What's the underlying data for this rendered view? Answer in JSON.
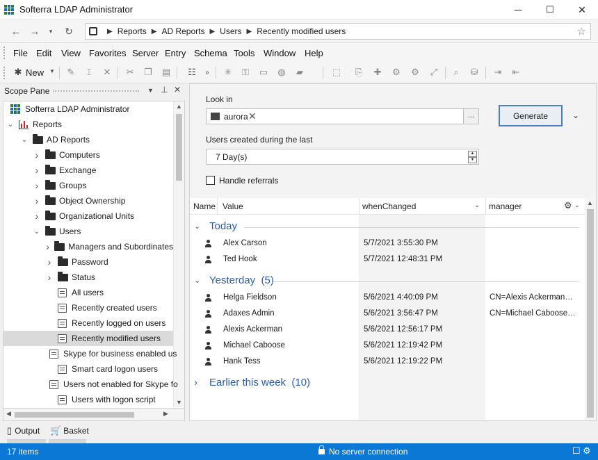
{
  "window": {
    "title": "Softerra LDAP Administrator",
    "controls": {
      "minimize": "─",
      "maximize": "☐",
      "close": "✕"
    }
  },
  "nav": {
    "back_icon": "arrow-left-icon",
    "forward_icon": "arrow-right-icon",
    "refresh_icon": "refresh-icon",
    "breadcrumbs": [
      "Reports",
      "AD Reports",
      "Users",
      "Recently modified users"
    ],
    "star_icon": "star-icon"
  },
  "menu": [
    "File",
    "Edit",
    "View",
    "Favorites",
    "Server",
    "Entry",
    "Schema",
    "Tools",
    "Window",
    "Help"
  ],
  "toolbar": {
    "new_label": "New"
  },
  "scope_pane": {
    "title": "Scope Pane",
    "tree": [
      {
        "label": "Softerra LDAP Administrator",
        "level": 0,
        "icon": "app-icon",
        "expander": ""
      },
      {
        "label": "Reports",
        "level": 0,
        "icon": "chart-icon",
        "expander": "expanded"
      },
      {
        "label": "AD Reports",
        "level": 1,
        "icon": "folder-icon",
        "expander": "expanded"
      },
      {
        "label": "Computers",
        "level": 2,
        "icon": "folder-icon",
        "expander": "collapsed"
      },
      {
        "label": "Exchange",
        "level": 2,
        "icon": "folder-icon",
        "expander": "collapsed"
      },
      {
        "label": "Groups",
        "level": 2,
        "icon": "folder-icon",
        "expander": "collapsed"
      },
      {
        "label": "Object Ownership",
        "level": 2,
        "icon": "folder-icon",
        "expander": "collapsed"
      },
      {
        "label": "Organizational Units",
        "level": 2,
        "icon": "folder-icon",
        "expander": "collapsed"
      },
      {
        "label": "Users",
        "level": 2,
        "icon": "folder-icon",
        "expander": "expanded"
      },
      {
        "label": "Managers and Subordinates",
        "level": 3,
        "icon": "folder-icon",
        "expander": "collapsed"
      },
      {
        "label": "Password",
        "level": 3,
        "icon": "folder-icon",
        "expander": "collapsed"
      },
      {
        "label": "Status",
        "level": 3,
        "icon": "folder-icon",
        "expander": "collapsed"
      },
      {
        "label": "All users",
        "level": 3,
        "icon": "report-icon",
        "expander": ""
      },
      {
        "label": "Recently created users",
        "level": 3,
        "icon": "report-icon",
        "expander": ""
      },
      {
        "label": "Recently logged on users",
        "level": 3,
        "icon": "report-icon",
        "expander": ""
      },
      {
        "label": "Recently modified users",
        "level": 3,
        "icon": "report-icon",
        "expander": "",
        "selected": true
      },
      {
        "label": "Skype for business enabled us",
        "level": 3,
        "icon": "report-icon",
        "expander": ""
      },
      {
        "label": "Smart card logon users",
        "level": 3,
        "icon": "report-icon",
        "expander": ""
      },
      {
        "label": "Users not enabled for Skype fo",
        "level": 3,
        "icon": "report-icon",
        "expander": ""
      },
      {
        "label": "Users with logon script",
        "level": 3,
        "icon": "report-icon",
        "expander": ""
      }
    ]
  },
  "form": {
    "look_in_label": "Look in",
    "look_in_value": "aurora",
    "browse_label": "...",
    "generate_label": "Generate",
    "period_label": "Users created during the last",
    "period_value": "7 Day(s)",
    "referrals_label": "Handle referrals",
    "referrals_checked": false
  },
  "grid": {
    "columns": [
      "Name",
      "Value",
      "whenChanged",
      "manager"
    ],
    "groups": [
      {
        "title": "Today",
        "expanded": true,
        "rows": [
          {
            "name": "Alex Carson",
            "whenChanged": "5/7/2021 3:55:30 PM",
            "manager": ""
          },
          {
            "name": "Ted Hook",
            "whenChanged": "5/7/2021 12:48:31 PM",
            "manager": ""
          }
        ]
      },
      {
        "title": "Yesterday  (5)",
        "expanded": true,
        "rows": [
          {
            "name": "Helga Fieldson",
            "whenChanged": "5/6/2021 4:40:09 PM",
            "manager": "CN=Alexis Ackerman…"
          },
          {
            "name": "Adaxes Admin",
            "whenChanged": "5/6/2021 3:56:47 PM",
            "manager": "CN=Michael Caboose…"
          },
          {
            "name": "Alexis Ackerman",
            "whenChanged": "5/6/2021 12:56:17 PM",
            "manager": ""
          },
          {
            "name": "Michael Caboose",
            "whenChanged": "5/6/2021 12:19:42 PM",
            "manager": ""
          },
          {
            "name": "Hank Tess",
            "whenChanged": "5/6/2021 12:19:22 PM",
            "manager": ""
          }
        ]
      },
      {
        "title": "Earlier this week  (10)",
        "expanded": false,
        "rows": []
      }
    ]
  },
  "bottom_tabs": [
    "Output",
    "Basket"
  ],
  "status": {
    "items": "17 items",
    "connection": "No server connection"
  },
  "colors": {
    "status_bar": "#0a78d4",
    "group_header": "#2a5db0",
    "selection": "#dadada"
  }
}
